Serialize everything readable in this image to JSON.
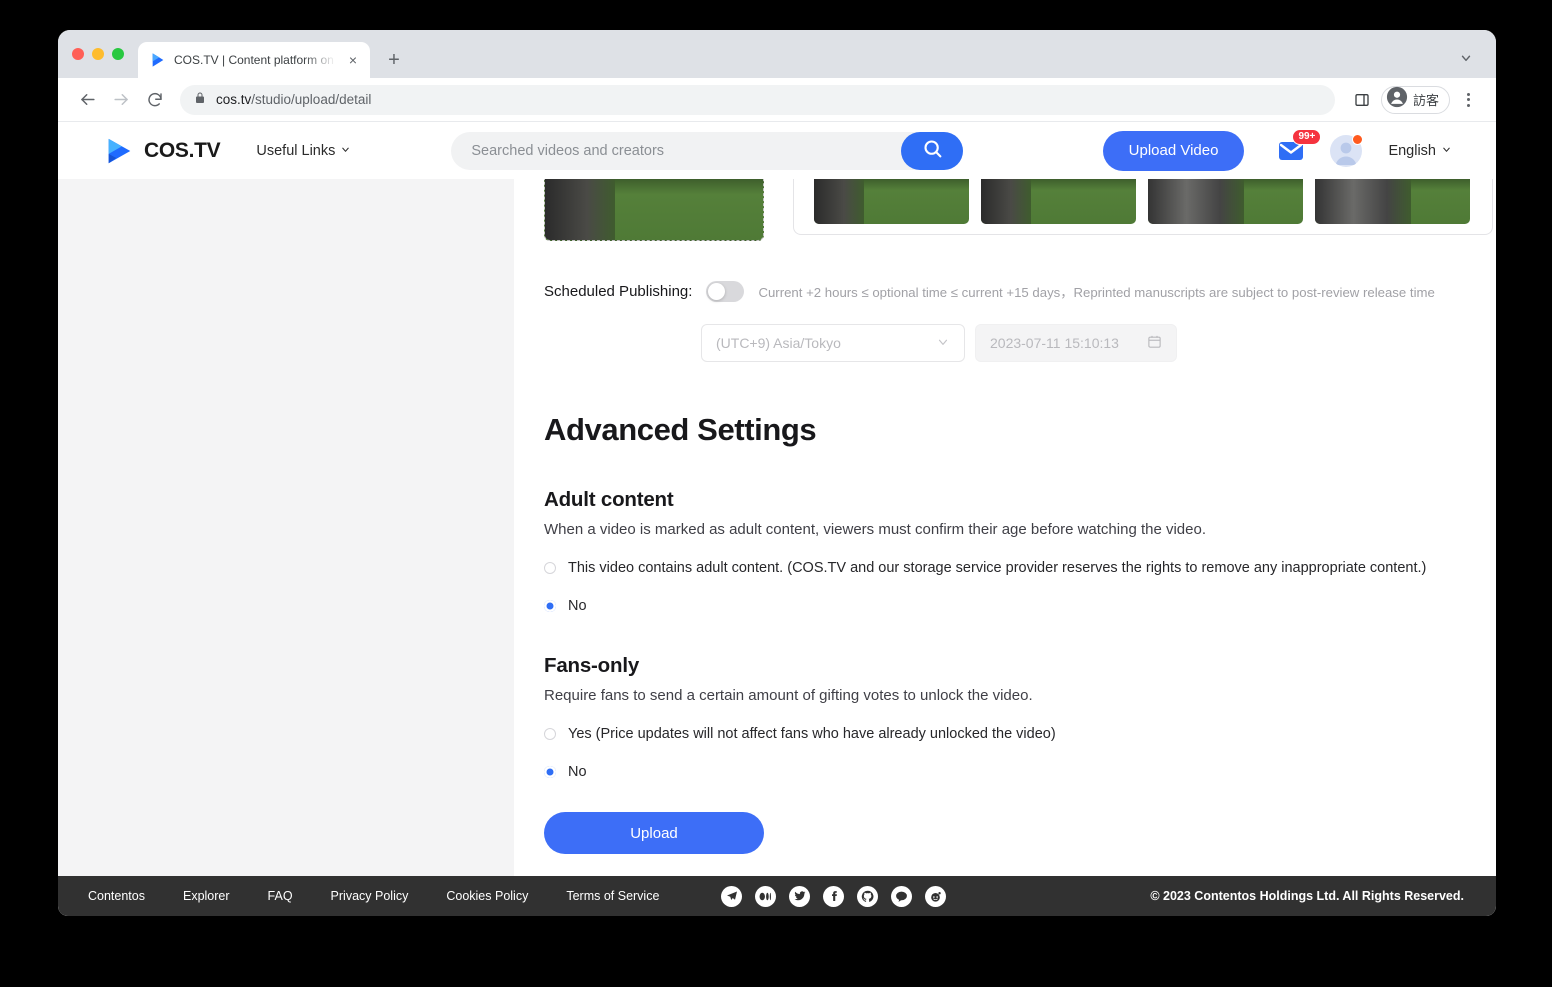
{
  "browser": {
    "tab_title": "COS.TV | Content platform on b",
    "url_domain": "cos.tv",
    "url_path": "/studio/upload/detail",
    "profile_name": "訪客",
    "new_tab_label": "+",
    "close_tab_label": "×"
  },
  "header": {
    "brand": "COS.TV",
    "useful_links": "Useful Links",
    "search_placeholder": "Searched videos and creators",
    "search_value": "",
    "upload_video": "Upload Video",
    "mail_badge": "99+",
    "language": "English"
  },
  "scheduled": {
    "label": "Scheduled Publishing:",
    "enabled": false,
    "hint": "Current +2 hours ≤ optional time ≤ current +15 days，Reprinted manuscripts are subject to post-review release time",
    "timezone": "(UTC+9)  Asia/Tokyo",
    "datetime": "2023-07-11 15:10:13"
  },
  "advanced": {
    "title": "Advanced Settings",
    "adult": {
      "heading": "Adult content",
      "description": "When a video is marked as adult content, viewers must confirm their age before watching the video.",
      "options": [
        {
          "label": "This video contains adult content. (COS.TV and our storage service provider reserves the rights to remove any inappropriate content.)",
          "selected": false
        },
        {
          "label": "No",
          "selected": true
        }
      ]
    },
    "fans": {
      "heading": "Fans-only",
      "description": "Require fans to send a certain amount of gifting votes to unlock the video.",
      "options": [
        {
          "label": "Yes (Price updates will not affect fans who have already unlocked the video)",
          "selected": false
        },
        {
          "label": "No",
          "selected": true
        }
      ]
    },
    "submit": "Upload"
  },
  "footer": {
    "links": [
      "Contentos",
      "Explorer",
      "FAQ",
      "Privacy Policy",
      "Cookies Policy",
      "Terms of Service"
    ],
    "social": [
      "telegram-icon",
      "medium-icon",
      "twitter-icon",
      "facebook-icon",
      "github-icon",
      "kakao-icon",
      "reddit-icon"
    ],
    "copyright": "© 2023 Contentos Holdings Ltd. All Rights Reserved."
  },
  "colors": {
    "brand_blue": "#3d6ef7",
    "accent_blue": "#2f6ef5",
    "badge_red": "#f5333f",
    "footer_bg": "#313131",
    "page_bg": "#f4f4f5"
  }
}
